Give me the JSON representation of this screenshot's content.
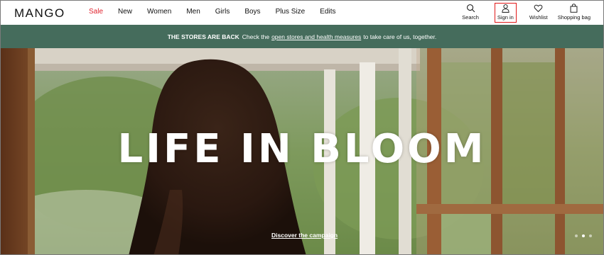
{
  "brand": {
    "logo": "MANGO"
  },
  "nav": {
    "items": [
      {
        "label": "Sale",
        "color": "#e0222d"
      },
      {
        "label": "New"
      },
      {
        "label": "Women"
      },
      {
        "label": "Men"
      },
      {
        "label": "Girls"
      },
      {
        "label": "Boys"
      },
      {
        "label": "Plus Size"
      },
      {
        "label": "Edits"
      }
    ]
  },
  "utilities": {
    "search": {
      "label": "Search",
      "icon": "search-icon"
    },
    "signin": {
      "label": "Sign in",
      "icon": "user-icon",
      "highlight": "#e11818"
    },
    "wishlist": {
      "label": "Wishlist",
      "icon": "heart-icon"
    },
    "bag": {
      "label": "Shopping bag",
      "icon": "bag-icon"
    }
  },
  "promo": {
    "bold": "THE STORES ARE BACK",
    "text_before": "Check the",
    "link": "open stores and health measures",
    "text_after": "to take care of us, together.",
    "background": "#456c5c"
  },
  "hero": {
    "title": "LIFE IN BLOOM",
    "cta": "Discover the campaign",
    "slides": {
      "count": 3,
      "active": 1
    }
  }
}
